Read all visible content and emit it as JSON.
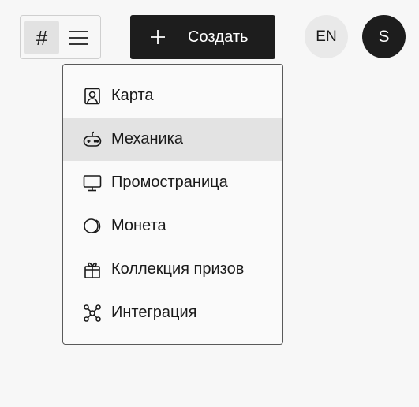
{
  "header": {
    "view_toggle": {
      "grid_glyph": "#",
      "grid_icon": "hash-icon",
      "list_icon": "menu-icon"
    },
    "create_button": {
      "label": "Создать",
      "icon": "plus-icon"
    },
    "language_button": {
      "label": "EN"
    },
    "avatar": {
      "initial": "S"
    }
  },
  "create_menu": {
    "items": [
      {
        "label": "Карта",
        "icon": "portrait-card-icon",
        "active": false
      },
      {
        "label": "Механика",
        "icon": "gamepad-icon",
        "active": true
      },
      {
        "label": "Промостраница",
        "icon": "monitor-icon",
        "active": false
      },
      {
        "label": "Монета",
        "icon": "coin-icon",
        "active": false
      },
      {
        "label": "Коллекция призов",
        "icon": "gift-icon",
        "active": false
      },
      {
        "label": "Интеграция",
        "icon": "network-icon",
        "active": false
      }
    ]
  },
  "colors": {
    "background": "#f7f7f7",
    "primary_dark": "#1d1d1d",
    "hover_row": "#e3e3e3",
    "lang_bg": "#e9e9e9"
  }
}
